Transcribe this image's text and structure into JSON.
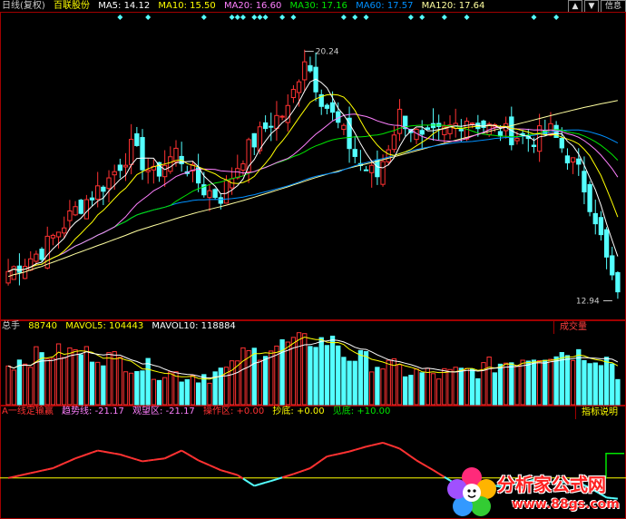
{
  "colors": {
    "up": "#ff3232",
    "down": "#54ffff",
    "ma5": "#ffffff",
    "ma10": "#ffff00",
    "ma20": "#ff80ff",
    "ma30": "#00e600",
    "ma60": "#0090ff",
    "ma120": "#ffffa0",
    "frame": "#a00000"
  },
  "header": {
    "period": "日线(复权)",
    "stock": "百联股份",
    "ma5": "MA5: 14.12",
    "ma10": "MA10: 15.50",
    "ma20": "MA20: 16.60",
    "ma30": "MA30: 17.16",
    "ma60": "MA60: 17.57",
    "ma120": "MA120: 17.64",
    "icons": [
      "up-arrow-icon",
      "down-arrow-icon",
      "left-arrow-icon",
      "right-arrow-icon",
      "plus-icon",
      "minus-icon"
    ],
    "info_label": "信息"
  },
  "volume_header": {
    "title": "总手",
    "value": "88740",
    "mavol5": "MAVOL5: 104443",
    "mavol10": "MAVOL10: 118884",
    "tag": "成交量"
  },
  "indicator_header": {
    "name": "A一线定输赢",
    "trend": "趋势线: -21.17",
    "watch": "观望区: -21.17",
    "operate": "操作区: +0.00",
    "bottom_fish": "抄底: +0.00",
    "see_bottom": "见底: +10.00",
    "tag": "指标说明"
  },
  "watermark": {
    "name": "分析家公式网",
    "url": "www.88gs.com"
  },
  "chart_data": [
    {
      "type": "candlestick",
      "series_names": [
        "MA5",
        "MA10",
        "MA20",
        "MA30",
        "MA60",
        "MA120"
      ],
      "ylim": [
        12.5,
        21.0
      ],
      "annotations": [
        {
          "label": "20.24",
          "value": 20.24
        },
        {
          "label": "12.94",
          "value": 12.94
        }
      ],
      "n": 110,
      "close_path": [
        [
          0,
          13.8
        ],
        [
          6,
          14.4
        ],
        [
          12,
          15.6
        ],
        [
          18,
          16.5
        ],
        [
          22,
          17.4
        ],
        [
          26,
          16.6
        ],
        [
          30,
          17.3
        ],
        [
          35,
          16.2
        ],
        [
          38,
          16.0
        ],
        [
          42,
          17.2
        ],
        [
          47,
          18.2
        ],
        [
          50,
          18.5
        ],
        [
          53,
          20.1
        ],
        [
          56,
          18.9
        ],
        [
          60,
          17.8
        ],
        [
          63,
          16.9
        ],
        [
          66,
          16.6
        ],
        [
          70,
          18.4
        ],
        [
          74,
          17.6
        ],
        [
          78,
          17.9
        ],
        [
          82,
          18.3
        ],
        [
          86,
          18.0
        ],
        [
          90,
          17.8
        ],
        [
          94,
          17.7
        ],
        [
          97,
          17.9
        ],
        [
          100,
          17.2
        ],
        [
          102,
          16.7
        ],
        [
          105,
          15.4
        ],
        [
          107,
          14.1
        ],
        [
          109,
          13.1
        ]
      ],
      "ma_endpoints": {
        "MA5": 14.12,
        "MA10": 15.5,
        "MA20": 16.6,
        "MA30": 17.16,
        "MA60": 17.57,
        "MA120": 17.64
      }
    },
    {
      "type": "bar",
      "name": "volume",
      "series_names": [
        "MAVOL5",
        "MAVOL10"
      ],
      "last": 88740,
      "mavol5": 104443,
      "mavol10": 118884,
      "ylim": [
        0,
        250000
      ]
    },
    {
      "type": "line",
      "name": "indicator",
      "values_last": {
        "trend": -21.17,
        "watch": -21.17,
        "operate": 0.0,
        "bottom_fish": 0.0,
        "see_bottom": 10.0
      },
      "ylim": [
        -40,
        60
      ],
      "curve": [
        [
          0,
          0
        ],
        [
          4,
          5
        ],
        [
          8,
          10
        ],
        [
          12,
          20
        ],
        [
          16,
          28
        ],
        [
          20,
          24
        ],
        [
          24,
          17
        ],
        [
          28,
          20
        ],
        [
          31,
          28
        ],
        [
          34,
          18
        ],
        [
          38,
          8
        ],
        [
          41,
          3
        ],
        [
          44,
          -8
        ],
        [
          47,
          -3
        ],
        [
          51,
          4
        ],
        [
          54,
          10
        ],
        [
          57,
          22
        ],
        [
          61,
          27
        ],
        [
          64,
          32
        ],
        [
          67,
          36
        ],
        [
          70,
          30
        ],
        [
          73,
          18
        ],
        [
          76,
          8
        ],
        [
          80,
          -6
        ],
        [
          84,
          -4
        ],
        [
          88,
          -9
        ],
        [
          92,
          -5
        ],
        [
          95,
          0
        ],
        [
          98,
          -6
        ],
        [
          101,
          -2
        ],
        [
          104,
          -10
        ],
        [
          107,
          -20
        ],
        [
          109,
          -21.17
        ]
      ]
    }
  ]
}
